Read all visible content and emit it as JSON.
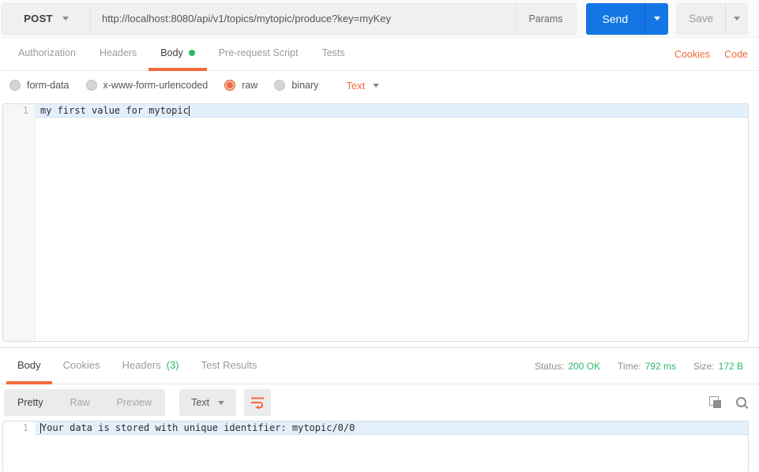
{
  "request_bar": {
    "method": "POST",
    "url": "http://localhost:8080/api/v1/topics/mytopic/produce?key=myKey",
    "params_label": "Params",
    "send_label": "Send",
    "save_label": "Save"
  },
  "request_tabs": {
    "items": [
      {
        "label": "Authorization"
      },
      {
        "label": "Headers"
      },
      {
        "label": "Body",
        "active": true,
        "unsaved_dot": true
      },
      {
        "label": "Pre-request Script"
      },
      {
        "label": "Tests"
      }
    ],
    "cookies_link": "Cookies",
    "code_link": "Code"
  },
  "body_options": {
    "modes": [
      "form-data",
      "x-www-form-urlencoded",
      "raw",
      "binary"
    ],
    "selected_mode": "raw",
    "format_label": "Text"
  },
  "request_editor": {
    "line_number": "1",
    "code": "my first value for mytopic"
  },
  "response_meta": {
    "tabs": [
      {
        "label": "Body",
        "active": true
      },
      {
        "label": "Cookies"
      },
      {
        "label": "Headers",
        "count": "(3)"
      },
      {
        "label": "Test Results"
      }
    ],
    "status_label": "Status:",
    "status_value": "200 OK",
    "time_label": "Time:",
    "time_value": "792 ms",
    "size_label": "Size:",
    "size_value": "172 B"
  },
  "response_toolbar": {
    "views": [
      "Pretty",
      "Raw",
      "Preview"
    ],
    "active_view": "Pretty",
    "format_label": "Text"
  },
  "response_editor": {
    "line_number": "1",
    "code": "Your data is stored with unique identifier: mytopic/0/0"
  },
  "colors": {
    "accent_orange": "#f26b3a",
    "status_green": "#2cb96c",
    "send_blue": "#1476e4"
  }
}
